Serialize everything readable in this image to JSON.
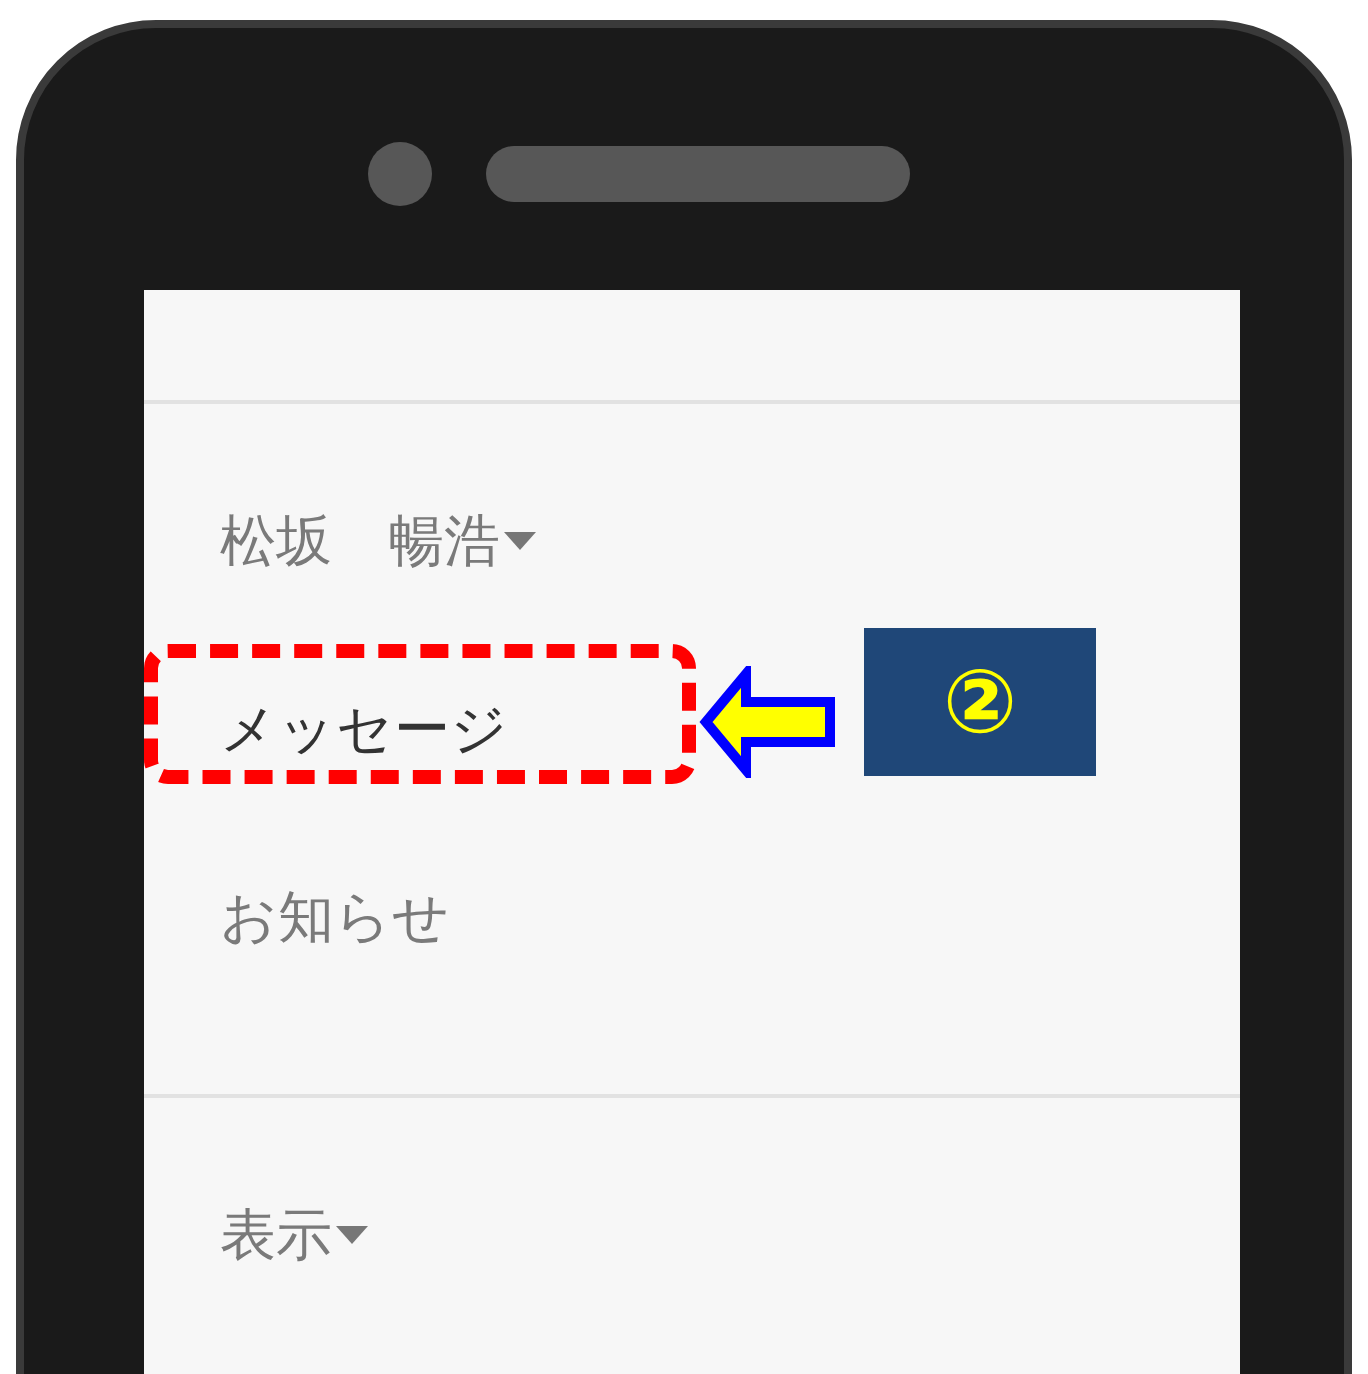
{
  "phone": {
    "screen": {
      "user_menu": {
        "label": "松坂　暢浩"
      },
      "items": [
        {
          "label": "メッセージ",
          "highlighted": true
        },
        {
          "label": "お知らせ",
          "highlighted": false
        }
      ],
      "view_menu": {
        "label": "表示"
      }
    }
  },
  "callout": {
    "label": "②"
  }
}
